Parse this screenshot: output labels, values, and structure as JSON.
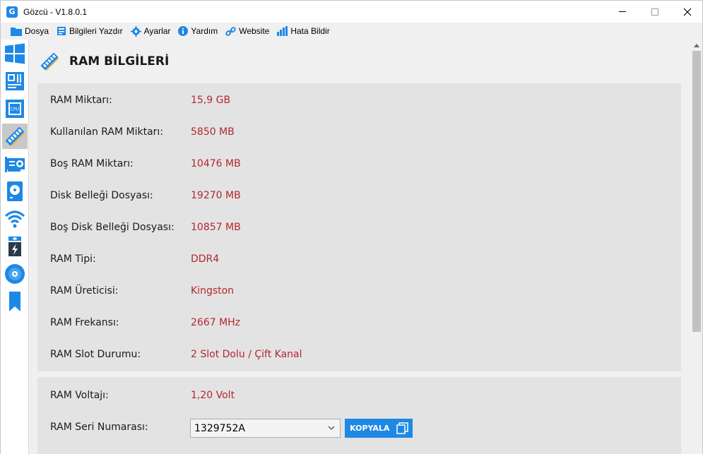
{
  "window": {
    "title": "Gözcü - V1.8.0.1",
    "logo_letter": "G"
  },
  "menu": [
    {
      "label": "Dosya",
      "icon": "folder-icon"
    },
    {
      "label": "Bilgileri Yazdır",
      "icon": "print-icon"
    },
    {
      "label": "Ayarlar",
      "icon": "gear-icon"
    },
    {
      "label": "Yardım",
      "icon": "info-icon"
    },
    {
      "label": "Website",
      "icon": "link-icon"
    },
    {
      "label": "Hata Bildir",
      "icon": "bar-chart-icon"
    }
  ],
  "sidebar": {
    "items": [
      "windows-icon",
      "motherboard-icon",
      "cpu-icon",
      "ram-icon",
      "gpu-icon",
      "disk-icon",
      "wifi-icon",
      "battery-icon",
      "disc-icon",
      "bookmark-icon"
    ],
    "active": "ram-icon",
    "cpu_text": "CPU"
  },
  "page": {
    "title": "RAM BİLGİLERİ"
  },
  "info_rows": [
    {
      "label": "RAM Miktarı:",
      "value": "15,9 GB"
    },
    {
      "label": "Kullanılan RAM Miktarı:",
      "value": "5850 MB"
    },
    {
      "label": "Boş RAM Miktarı:",
      "value": "10476 MB"
    },
    {
      "label": "Disk Belleği Dosyası:",
      "value": "19270 MB"
    },
    {
      "label": "Boş Disk Belleği Dosyası:",
      "value": "10857 MB"
    },
    {
      "label": "RAM Tipi:",
      "value": "DDR4"
    },
    {
      "label": "RAM Üreticisi:",
      "value": "Kingston"
    },
    {
      "label": "RAM Frekansı:",
      "value": "2667 MHz"
    },
    {
      "label": "RAM Slot Durumu:",
      "value": "2 Slot Dolu / Çift Kanal"
    }
  ],
  "voltage": {
    "label": "RAM Voltajı:",
    "value": "1,20 Volt"
  },
  "serial": {
    "label": "RAM Seri Numarası:",
    "selected": "1329752A",
    "copy_label": "KOPYALA"
  },
  "colors": {
    "accent": "#1e88e5",
    "value_text": "#b3272d",
    "panel": "#e3e3e3"
  }
}
